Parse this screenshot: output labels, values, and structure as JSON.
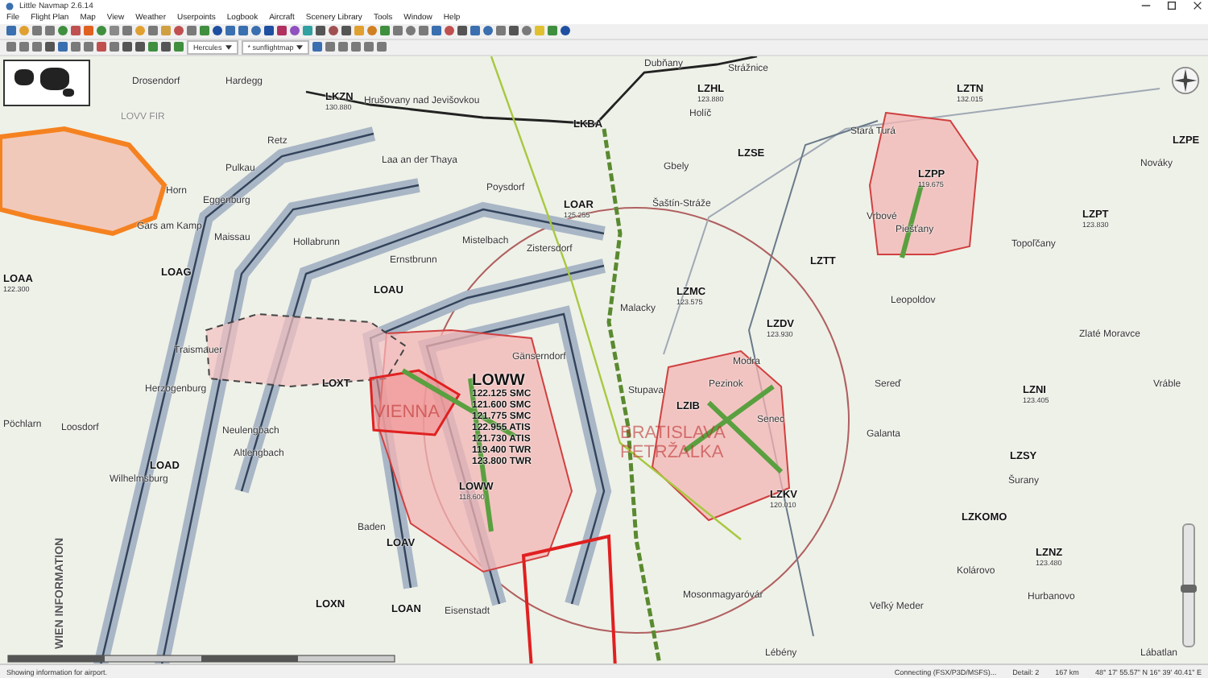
{
  "window": {
    "title": "Little Navmap 2.6.14"
  },
  "menu": [
    "File",
    "Flight Plan",
    "Map",
    "View",
    "Weather",
    "Userpoints",
    "Logbook",
    "Aircraft",
    "Scenery Library",
    "Tools",
    "Window",
    "Help"
  ],
  "toolbar": {
    "combos": [
      {
        "value": "Hercules"
      },
      {
        "value": "* sunflightmap"
      }
    ]
  },
  "map_labels": [
    {
      "kind": "town",
      "text": "Dubňany"
    },
    {
      "kind": "town",
      "text": "Strážnice"
    },
    {
      "kind": "town",
      "text": "Drosendorf"
    },
    {
      "kind": "town",
      "text": "Hardegg"
    },
    {
      "kind": "airport",
      "text": "LKZN",
      "freq": "130.880"
    },
    {
      "kind": "town",
      "text": "Hrušovany nad Jevišovkou"
    },
    {
      "kind": "airport",
      "text": "LZHL",
      "freq": "123.880"
    },
    {
      "kind": "town",
      "text": "Holíč"
    },
    {
      "kind": "airport",
      "text": "LZTN",
      "freq": "132.015"
    },
    {
      "kind": "fir",
      "text": "LOVV FIR"
    },
    {
      "kind": "airport",
      "text": "LKBA"
    },
    {
      "kind": "town",
      "text": "Retz"
    },
    {
      "kind": "town",
      "text": "Laa an der Thaya"
    },
    {
      "kind": "town",
      "text": "Pulkau"
    },
    {
      "kind": "town",
      "text": "Gbely"
    },
    {
      "kind": "airport",
      "text": "LZSE"
    },
    {
      "kind": "airport",
      "text": "LZPE"
    },
    {
      "kind": "town",
      "text": "Stará Turá"
    },
    {
      "kind": "town",
      "text": "Nováky"
    },
    {
      "kind": "town",
      "text": "Horn"
    },
    {
      "kind": "town",
      "text": "Eggenburg"
    },
    {
      "kind": "town",
      "text": "Poysdorf"
    },
    {
      "kind": "airport",
      "text": "LOAR",
      "freq": "125.255"
    },
    {
      "kind": "town",
      "text": "Šaštín-Stráže"
    },
    {
      "kind": "airport",
      "text": "LZPP",
      "freq": "119.675"
    },
    {
      "kind": "town",
      "text": "Vrbové"
    },
    {
      "kind": "airport",
      "text": "LZPT",
      "freq": "123.830"
    },
    {
      "kind": "town",
      "text": "Gars am Kamp"
    },
    {
      "kind": "town",
      "text": "Maissau"
    },
    {
      "kind": "town",
      "text": "Hollabrunn"
    },
    {
      "kind": "town",
      "text": "Mistelbach"
    },
    {
      "kind": "town",
      "text": "Zistersdorf"
    },
    {
      "kind": "town",
      "text": "Piešťany"
    },
    {
      "kind": "town",
      "text": "Topoľčany"
    },
    {
      "kind": "town",
      "text": "Ernstbrunn"
    },
    {
      "kind": "airport",
      "text": "LZTT"
    },
    {
      "kind": "airport",
      "text": "LOAG"
    },
    {
      "kind": "airport",
      "text": "LOAA",
      "freq": "122.300"
    },
    {
      "kind": "airport",
      "text": "LOAU"
    },
    {
      "kind": "airport",
      "text": "LZMC",
      "freq": "123.575"
    },
    {
      "kind": "town",
      "text": "Malacky"
    },
    {
      "kind": "town",
      "text": "Leopoldov"
    },
    {
      "kind": "airport",
      "text": "LZDV",
      "freq": "123.930"
    },
    {
      "kind": "town",
      "text": "Zlaté Moravce"
    },
    {
      "kind": "town",
      "text": "Traismauer"
    },
    {
      "kind": "town",
      "text": "Gänserndorf"
    },
    {
      "kind": "town",
      "text": "Modra"
    },
    {
      "kind": "airport",
      "text": "LOXT"
    },
    {
      "kind": "hub",
      "text": "LOWW",
      "freqs": [
        "122.125 SMC",
        "121.600 SMC",
        "121.775 SMC",
        "122.955 ATIS",
        "121.730 ATIS",
        "119.400 TWR",
        "123.800 TWR"
      ]
    },
    {
      "kind": "town",
      "text": "Herzogenburg"
    },
    {
      "kind": "town",
      "text": "Pezinok"
    },
    {
      "kind": "town",
      "text": "Sereď"
    },
    {
      "kind": "airport",
      "text": "LZNI",
      "freq": "123.405"
    },
    {
      "kind": "town",
      "text": "Vráble"
    },
    {
      "kind": "town",
      "text": "Stupava"
    },
    {
      "kind": "airspace",
      "text": "VIENNA"
    },
    {
      "kind": "airport",
      "text": "LZIB"
    },
    {
      "kind": "town",
      "text": "Senec"
    },
    {
      "kind": "town",
      "text": "Pöchlarn"
    },
    {
      "kind": "town",
      "text": "Loosdorf"
    },
    {
      "kind": "town",
      "text": "Neulengbach"
    },
    {
      "kind": "airspace",
      "text": "BRATISLAVA PETRŽALKA"
    },
    {
      "kind": "town",
      "text": "Galanta"
    },
    {
      "kind": "town",
      "text": "Altlengbach"
    },
    {
      "kind": "airport",
      "text": "LZSY"
    },
    {
      "kind": "airport",
      "text": "LOAD"
    },
    {
      "kind": "town",
      "text": "Šurany"
    },
    {
      "kind": "town",
      "text": "Wilhelmsburg"
    },
    {
      "kind": "airport",
      "text": "LOWW",
      "freq": "118.600"
    },
    {
      "kind": "airport",
      "text": "LZKV",
      "freq": "120.010"
    },
    {
      "kind": "airport",
      "text": "LZKOMO"
    },
    {
      "kind": "town",
      "text": "Baden"
    },
    {
      "kind": "airport",
      "text": "LOAV"
    },
    {
      "kind": "airport",
      "text": "LZNZ",
      "freq": "123.480"
    },
    {
      "kind": "town",
      "text": "Kolárovo"
    },
    {
      "kind": "town",
      "text": "Mosonmagyaróvár"
    },
    {
      "kind": "town",
      "text": "Hurbanovo"
    },
    {
      "kind": "airport",
      "text": "LOXN"
    },
    {
      "kind": "airport",
      "text": "LOAN"
    },
    {
      "kind": "town",
      "text": "Eisenstadt"
    },
    {
      "kind": "town",
      "text": "Veľký Meder"
    },
    {
      "kind": "town",
      "text": "Lébény"
    },
    {
      "kind": "town",
      "text": "Lábatlan"
    },
    {
      "kind": "vertical",
      "text": "WIEN INFORMATION"
    }
  ],
  "map_zoom": {
    "level": 0.45
  },
  "status_bar": [
    "Showing information for airport.",
    "Connecting (FSX/P3D/MSFS)...",
    "Detail: 2",
    "167 km",
    "48° 17' 55.57\" N 16° 39' 40.41\" E"
  ]
}
